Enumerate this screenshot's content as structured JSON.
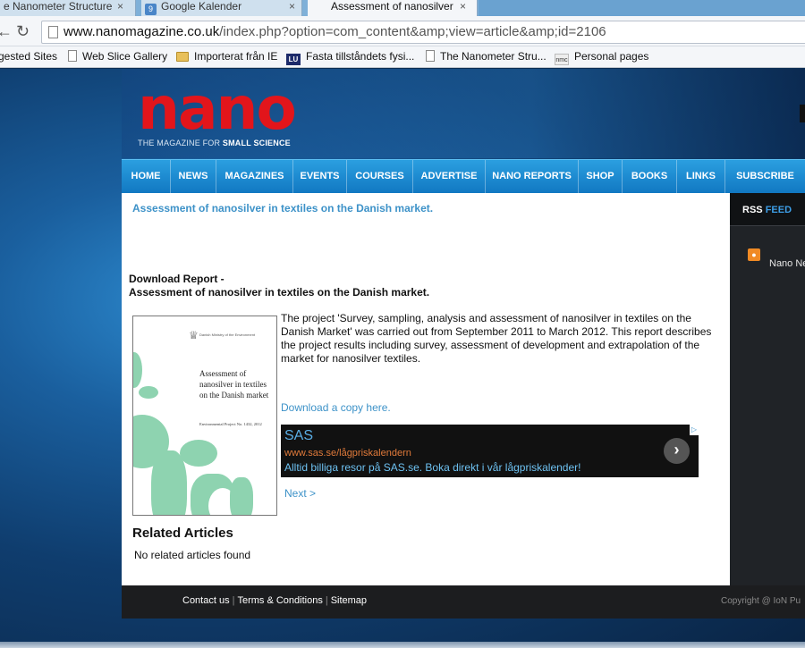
{
  "browser": {
    "tabs": [
      {
        "title": "e Nanometer Structure",
        "close": "×"
      },
      {
        "title": "Google Kalender",
        "close": "×",
        "favicon": "9"
      },
      {
        "title": "Assessment of nanosilver",
        "close": "×"
      }
    ],
    "url_host": "www.nanomagazine.co.uk",
    "url_path": "/index.php?option=com_content&amp;view=article&amp;id=2106",
    "bookmarks": [
      {
        "label": "gested Sites",
        "icon": "none"
      },
      {
        "label": "Web Slice Gallery",
        "icon": "document-icon"
      },
      {
        "label": "Importerat från IE",
        "icon": "folder-icon"
      },
      {
        "label": "Fasta tillståndets fysi...",
        "icon": "lu-icon",
        "icon_text": "LU"
      },
      {
        "label": "The Nanometer Stru...",
        "icon": "document-icon"
      },
      {
        "label": "Personal pages",
        "icon": "nmc-icon",
        "icon_text": "nmc"
      }
    ]
  },
  "site": {
    "logo_word": "nano",
    "tagline_prefix": "THE MAGAZINE FOR ",
    "tagline_bold": "SMALL SCIENCE",
    "nav": [
      "HOME",
      "NEWS",
      "MAGAZINES",
      "EVENTS",
      "COURSES",
      "ADVERTISE",
      "NANO REPORTS",
      "SHOP",
      "BOOKS",
      "LINKS",
      "SUBSCRIBE"
    ],
    "accent": "#3d92c8",
    "logo_color": "#e2151b"
  },
  "article": {
    "title": "Assessment of nanosilver in textiles on the Danish market.",
    "download_line1": "Download Report -",
    "download_line2": "Assessment of nanosilver in textiles on the Danish market.",
    "cover": {
      "ministry": "Danish Ministry of the Environment",
      "title": "Assessment of nanosilver in textiles on the Danish market",
      "subtitle": "Environmental Project No. 1432, 2012"
    },
    "summary": "The project 'Survey, sampling, analysis and assessment of nanosilver in textiles on the Danish Market' was carried out from September 2011 to March 2012. This report describes the project results including survey, assessment of development and extrapolation of the market for nanosilver textiles.",
    "download_link": "Download a copy here.",
    "ad": {
      "title": "SAS",
      "url": "www.sas.se/lågpriskalendern",
      "text": "Alltid billiga resor på SAS.se. Boka direkt i vår lågpriskalender!",
      "arrow": "›"
    },
    "next": "Next >",
    "related_heading": "Related Articles",
    "related_empty": "No related articles found"
  },
  "sidebar": {
    "rss": "RSS",
    "feed": "FEED",
    "item": "Nano Ne"
  },
  "footer": {
    "links": [
      "Contact us",
      "Terms & Conditions",
      "Sitemap"
    ],
    "copyright": "Copyright @ IoN Pu"
  }
}
